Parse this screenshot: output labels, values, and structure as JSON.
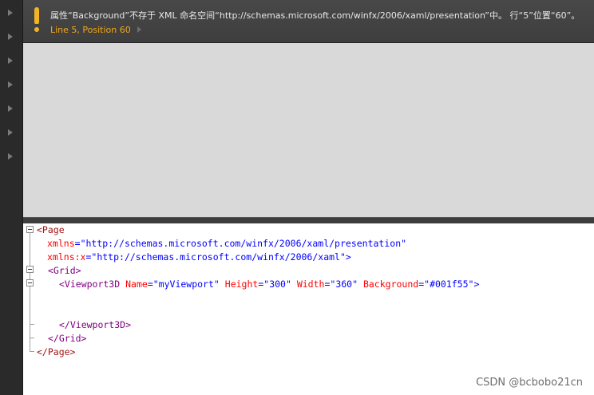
{
  "error": {
    "message": "属性“Background”不存于 XML 命名空间“http://schemas.microsoft.com/winfx/2006/xaml/presentation”中。 行“5”位置“60”。",
    "location": "Line 5, Position 60"
  },
  "colors": {
    "warning": "#f2b423",
    "location_text": "#f2a81d",
    "design_surface": "#d9d9d9"
  },
  "code": {
    "l1_tag": "<Page",
    "l2_attr": "xmlns",
    "l2_eq": "=",
    "l2_val": "\"http://schemas.microsoft.com/winfx/2006/xaml/presentation\"",
    "l3_attr": "xmlns:x",
    "l3_eq": "=",
    "l3_val": "\"http://schemas.microsoft.com/winfx/2006/xaml\"",
    "l3_close": ">",
    "l4_tag": "<Grid>",
    "l5_open": "<Viewport3D",
    "l5_a1": "Name",
    "l5_v1": "\"myViewport\"",
    "l5_a2": "Height",
    "l5_v2": "\"300\"",
    "l5_a3": "Width",
    "l5_v3": "\"360\"",
    "l5_a4": "Background",
    "l5_v4": "\"#001f55\"",
    "l5_close": ">",
    "l6_tag": "</Viewport3D>",
    "l7_tag": "</Grid>",
    "l8_tag": "</Page>"
  },
  "watermark": "CSDN @bcbobo21cn"
}
